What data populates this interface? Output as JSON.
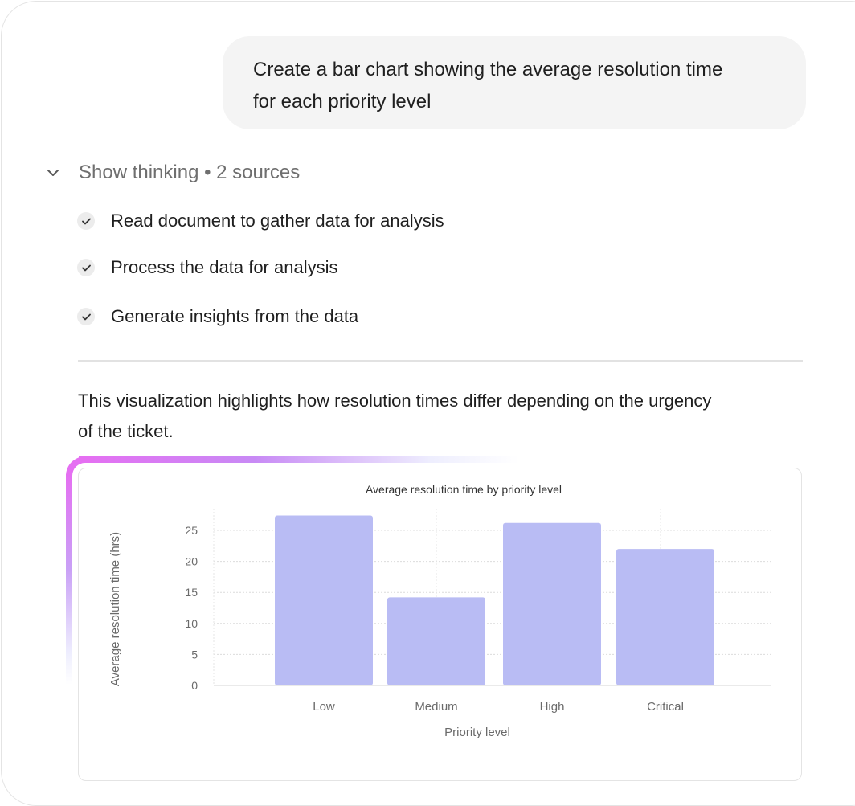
{
  "user_message": {
    "line1": "Create a bar chart showing the average resolution time",
    "line2": "for each priority level"
  },
  "thinking": {
    "toggle_icon": "chevron-down-icon",
    "label": "Show thinking • 2 sources",
    "steps": [
      {
        "icon": "check-icon",
        "text": "Read document to gather data for analysis"
      },
      {
        "icon": "check-icon",
        "text": "Process the data for analysis"
      },
      {
        "icon": "check-icon",
        "text": "Generate insights from the data"
      }
    ]
  },
  "answer": {
    "line1": "This visualization highlights how resolution times differ depending on the urgency",
    "line2": "of the ticket."
  },
  "colors": {
    "bar": "#b9bcf4",
    "accent_glow": "#e56ff2",
    "bubble": "#f4f4f4"
  },
  "chart_data": {
    "type": "bar",
    "title": "Average resolution time by priority level",
    "categories": [
      "Low",
      "Medium",
      "High",
      "Critical"
    ],
    "values": [
      27.4,
      14.2,
      26.2,
      22.0
    ],
    "xlabel": "Priority level",
    "ylabel": "Average resolution time (hrs)",
    "ylim": [
      0,
      28.5
    ],
    "yticks": [
      0,
      5,
      10,
      15,
      20,
      25
    ],
    "grid": true
  }
}
